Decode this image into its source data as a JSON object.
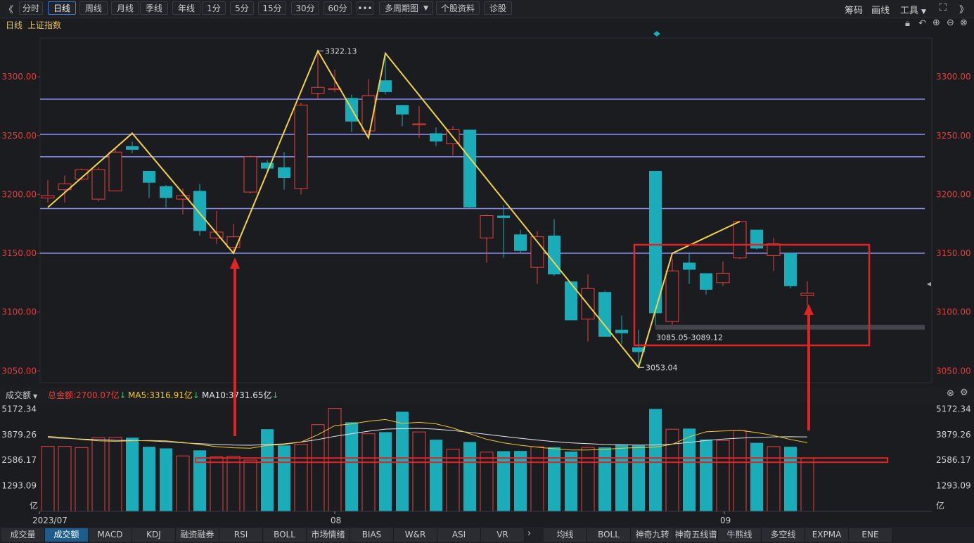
{
  "toolbar": {
    "back": "《",
    "buttons": [
      "分时",
      "日线",
      "周线",
      "月线",
      "季线",
      "年线",
      "1分",
      "5分",
      "15分",
      "30分",
      "60分"
    ],
    "active": "日线",
    "more": "•••",
    "multi": "多周期图",
    "stock_info": "个股资料",
    "diagnose": "诊股",
    "right": [
      "筹码",
      "画线",
      "工具"
    ],
    "fullscreen": "⛶",
    "forward": "》"
  },
  "title": {
    "period": "日线",
    "name": "上证指数"
  },
  "chart_data": [
    {
      "type": "candlestick",
      "title": "上证指数 日线",
      "ylim": [
        3040,
        3333
      ],
      "yticks": [
        3300,
        3250,
        3200,
        3150,
        3100,
        3050
      ],
      "ytick_labels": [
        "3300.00",
        "3250.00",
        "3200.00",
        "3150.00",
        "3100.00",
        "3050.00"
      ],
      "candles": [
        {
          "o": 3197,
          "c": 3199,
          "h": 3212,
          "l": 3193
        },
        {
          "o": 3204,
          "c": 3209,
          "h": 3216,
          "l": 3193
        },
        {
          "o": 3213,
          "c": 3221,
          "h": 3222,
          "l": 3212
        },
        {
          "o": 3196,
          "c": 3221,
          "h": 3223,
          "l": 3194
        },
        {
          "o": 3203,
          "c": 3236,
          "h": 3240,
          "l": 3203
        },
        {
          "o": 3241,
          "c": 3238,
          "h": 3245,
          "l": 3235
        },
        {
          "o": 3220,
          "c": 3210,
          "h": 3220,
          "l": 3197
        },
        {
          "o": 3207,
          "c": 3197,
          "h": 3208,
          "l": 3189
        },
        {
          "o": 3196,
          "c": 3199,
          "h": 3205,
          "l": 3183
        },
        {
          "o": 3203,
          "c": 3169,
          "h": 3209,
          "l": 3165
        },
        {
          "o": 3163,
          "c": 3168,
          "h": 3186,
          "l": 3158
        },
        {
          "o": 3155,
          "c": 3164,
          "h": 3175,
          "l": 3150
        },
        {
          "o": 3202,
          "c": 3232,
          "h": 3233,
          "l": 3201
        },
        {
          "o": 3227,
          "c": 3222,
          "h": 3229,
          "l": 3219
        },
        {
          "o": 3223,
          "c": 3214,
          "h": 3236,
          "l": 3204
        },
        {
          "o": 3205,
          "c": 3276,
          "h": 3278,
          "l": 3200
        },
        {
          "o": 3286,
          "c": 3291,
          "h": 3322,
          "l": 3281
        },
        {
          "o": 3290,
          "c": 3290,
          "h": 3306,
          "l": 3287
        },
        {
          "o": 3282,
          "c": 3262,
          "h": 3285,
          "l": 3253
        },
        {
          "o": 3254,
          "c": 3284,
          "h": 3298,
          "l": 3251
        },
        {
          "o": 3297,
          "c": 3287,
          "h": 3318,
          "l": 3285
        },
        {
          "o": 3276,
          "c": 3268,
          "h": 3276,
          "l": 3258
        },
        {
          "o": 3260,
          "c": 3260,
          "h": 3275,
          "l": 3248
        },
        {
          "o": 3252,
          "c": 3245,
          "h": 3257,
          "l": 3241
        },
        {
          "o": 3243,
          "c": 3255,
          "h": 3258,
          "l": 3233
        },
        {
          "o": 3255,
          "c": 3189,
          "h": 3255,
          "l": 3188
        },
        {
          "o": 3163,
          "c": 3182,
          "h": 3183,
          "l": 3142
        },
        {
          "o": 3182,
          "c": 3180,
          "h": 3191,
          "l": 3146
        },
        {
          "o": 3166,
          "c": 3152,
          "h": 3170,
          "l": 3150
        },
        {
          "o": 3138,
          "c": 3164,
          "h": 3169,
          "l": 3124
        },
        {
          "o": 3165,
          "c": 3132,
          "h": 3179,
          "l": 3131
        },
        {
          "o": 3126,
          "c": 3093,
          "h": 3126,
          "l": 3093
        },
        {
          "o": 3094,
          "c": 3120,
          "h": 3132,
          "l": 3075
        },
        {
          "o": 3117,
          "c": 3079,
          "h": 3118,
          "l": 3079
        },
        {
          "o": 3085,
          "c": 3082,
          "h": 3097,
          "l": 3073
        },
        {
          "o": 3070,
          "c": 3066,
          "h": 3085,
          "l": 3053
        },
        {
          "o": 3220,
          "c": 3099,
          "h": 3220,
          "l": 3088
        },
        {
          "o": 3092,
          "c": 3135,
          "h": 3145,
          "l": 3086
        },
        {
          "o": 3142,
          "c": 3136,
          "h": 3150,
          "l": 3124
        },
        {
          "o": 3133,
          "c": 3119,
          "h": 3133,
          "l": 3115
        },
        {
          "o": 3125,
          "c": 3133,
          "h": 3143,
          "l": 3122
        },
        {
          "o": 3146,
          "c": 3177,
          "h": 3177,
          "l": 3145
        },
        {
          "o": 3170,
          "c": 3154,
          "h": 3170,
          "l": 3153
        },
        {
          "o": 3148,
          "c": 3158,
          "h": 3163,
          "l": 3135
        },
        {
          "o": 3150,
          "c": 3122,
          "h": 3150,
          "l": 3120
        },
        {
          "o": 3114,
          "c": 3116,
          "h": 3126,
          "l": 3105
        }
      ],
      "zigzag": [
        3189,
        3252,
        3150,
        3322,
        3248,
        3320,
        3053,
        3150,
        3177
      ],
      "hlines": [
        3281,
        3251,
        3232,
        3188,
        3150
      ],
      "annotations": {
        "high": "3322.13",
        "low": "3053.04",
        "range": "3085.05-3089.12"
      }
    },
    {
      "type": "bar",
      "title": "成交额",
      "ylim": [
        0,
        5400
      ],
      "ytick_labels": [
        "5172.34",
        "3879.26",
        "2586.17",
        "1293.09"
      ],
      "unit": "亿",
      "xtick_labels": [
        "2023/07",
        "08",
        "09"
      ],
      "values": [
        3280,
        3280,
        3220,
        3720,
        3740,
        3720,
        3260,
        3180,
        2800,
        3080,
        2750,
        2780,
        2590,
        4150,
        3330,
        3390,
        4380,
        5200,
        4500,
        3920,
        4000,
        5030,
        4010,
        3620,
        3140,
        3500,
        2990,
        3040,
        3050,
        3260,
        3240,
        3020,
        3230,
        3230,
        3380,
        3330,
        5172,
        4150,
        4180,
        3630,
        3580,
        4080,
        3460,
        3270,
        3260,
        2700
      ],
      "ma5": [
        3790,
        3720,
        3630,
        3560,
        3540,
        3560,
        3580,
        3560,
        3480,
        3380,
        3270,
        3210,
        3190,
        3330,
        3380,
        3500,
        3870,
        4330,
        4420,
        4550,
        4640,
        4440,
        4500,
        4420,
        4210,
        3920,
        3640,
        3460,
        3340,
        3240,
        3160,
        3100,
        3100,
        3130,
        3190,
        3220,
        3240,
        3390,
        3760,
        4020,
        4060,
        4090,
        3980,
        3830,
        3630,
        3470
      ],
      "ma10": [
        3720,
        3690,
        3650,
        3620,
        3590,
        3580,
        3560,
        3520,
        3460,
        3420,
        3380,
        3350,
        3340,
        3370,
        3410,
        3500,
        3630,
        3790,
        3920,
        4050,
        4150,
        4180,
        4190,
        4150,
        4080,
        3990,
        3890,
        3790,
        3690,
        3600,
        3520,
        3460,
        3420,
        3380,
        3360,
        3350,
        3350,
        3400,
        3480,
        3580,
        3650,
        3700,
        3730,
        3760,
        3770,
        3760
      ]
    }
  ],
  "volume_header": {
    "label": "成交额",
    "total": "总金额:2700.07亿",
    "ma5": "MA5:3316.91亿",
    "ma10": "MA10:3731.65亿"
  },
  "bottom_tabs_left": [
    "成交量",
    "成交额",
    "MACD",
    "KDJ",
    "融资融券",
    "RSI",
    "BOLL",
    "市场情绪",
    "BIAS",
    "W&R",
    "ASI",
    "VR"
  ],
  "bottom_active": "成交额",
  "bottom_tabs_right": [
    "均线",
    "BOLL",
    "神奇九转",
    "神奇五线谱",
    "牛熊线",
    "多空线",
    "EXPMA",
    "ENE"
  ],
  "colors": {
    "up": "#e8403e",
    "down": "#1aacb8",
    "zigzag": "#f0d24a",
    "hline": "#8a8cf0",
    "ma5": "#f0c832",
    "ma10": "#e6e6e6",
    "box": "#e02424",
    "arrow": "#e02424",
    "axis_red": "#e0403a"
  }
}
